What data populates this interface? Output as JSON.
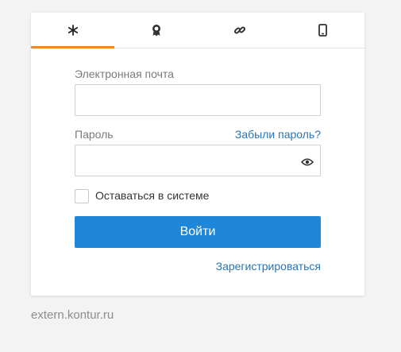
{
  "tabs": [
    {
      "icon": "asterisk-icon",
      "active": true
    },
    {
      "icon": "certificate-icon",
      "active": false
    },
    {
      "icon": "link-icon",
      "active": false
    },
    {
      "icon": "mobile-phone-icon",
      "active": false
    }
  ],
  "form": {
    "email_label": "Электронная почта",
    "email_value": "",
    "password_label": "Пароль",
    "password_value": "",
    "forgot_link": "Забыли пароль?",
    "remember_label": "Оставаться в системе",
    "remember_checked": false,
    "submit_label": "Войти",
    "register_link": "Зарегистрироваться"
  },
  "footer": {
    "domain": "extern.kontur.ru"
  },
  "colors": {
    "accent_tab": "#f08a1d",
    "button": "#1f87d9",
    "link": "#2a74b5"
  }
}
